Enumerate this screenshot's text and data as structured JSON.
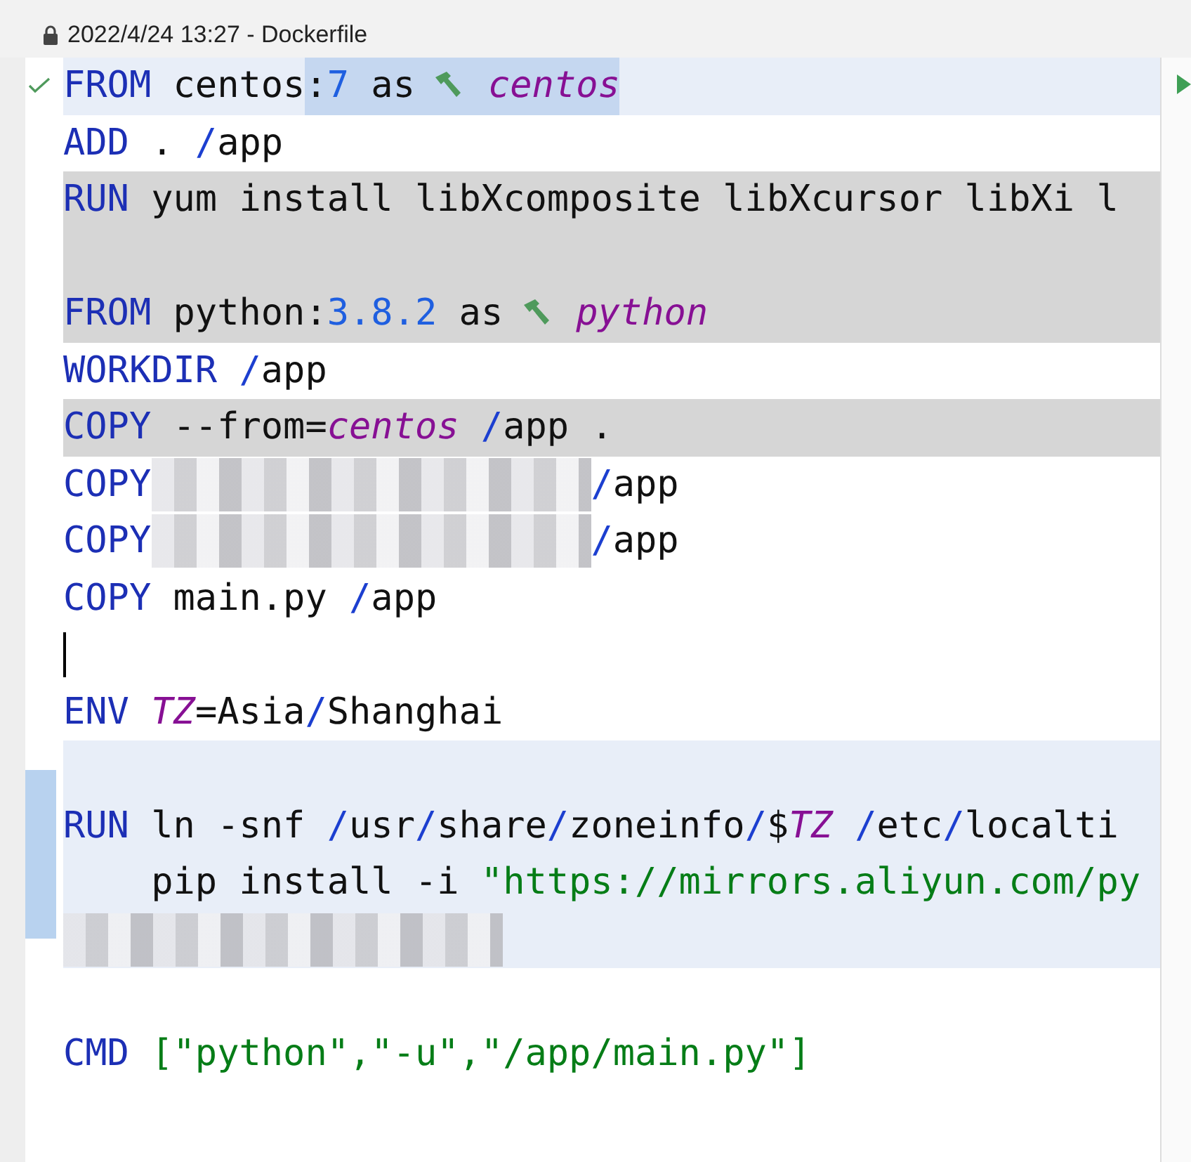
{
  "title": {
    "text": "2022/4/24 13:27 - Dockerfile",
    "locked": true
  },
  "lines": [
    {
      "kind": "current",
      "gutter": {
        "kind": "check"
      },
      "tokens": [
        {
          "kind": "kw",
          "t": "FROM"
        },
        {
          "kind": "plain",
          "t": " centos"
        },
        {
          "kind": "selection",
          "children": [
            {
              "kind": "plain",
              "t": ":"
            },
            {
              "kind": "num",
              "t": "7"
            },
            {
              "kind": "plain",
              "t": " as"
            },
            {
              "kind": "hammer"
            },
            {
              "kind": "var",
              "t": "centos"
            }
          ]
        }
      ]
    },
    {
      "kind": "plain",
      "tokens": [
        {
          "kind": "kw",
          "t": "ADD"
        },
        {
          "kind": "plain",
          "t": " ."
        },
        {
          "kind": "op",
          "t": " /"
        },
        {
          "kind": "plain",
          "t": "app"
        }
      ]
    },
    {
      "kind": "gray",
      "tokens": [
        {
          "kind": "kw",
          "t": "RUN"
        },
        {
          "kind": "plain",
          "t": " yum install libXcomposite libXcursor libXi l"
        }
      ]
    },
    {
      "kind": "gray"
    },
    {
      "kind": "gray",
      "tokens": [
        {
          "kind": "kw",
          "t": "FROM"
        },
        {
          "kind": "plain",
          "t": " python:"
        },
        {
          "kind": "num",
          "t": "3.8.2"
        },
        {
          "kind": "plain",
          "t": " as"
        },
        {
          "kind": "hammer"
        },
        {
          "kind": "var",
          "t": "python"
        }
      ]
    },
    {
      "kind": "plain",
      "tokens": [
        {
          "kind": "kw",
          "t": "WORKDIR"
        },
        {
          "kind": "op",
          "t": " /"
        },
        {
          "kind": "plain",
          "t": "app"
        }
      ]
    },
    {
      "kind": "gray",
      "tokens": [
        {
          "kind": "kw",
          "t": "COPY"
        },
        {
          "kind": "plain",
          "t": " --from="
        },
        {
          "kind": "var",
          "t": "centos"
        },
        {
          "kind": "op",
          "t": " /"
        },
        {
          "kind": "plain",
          "t": "app ."
        }
      ]
    },
    {
      "kind": "plain",
      "tokens": [
        {
          "kind": "kw",
          "t": "COPY"
        },
        {
          "kind": "blur"
        },
        {
          "kind": "op",
          "t": "/"
        },
        {
          "kind": "plain",
          "t": "app"
        }
      ]
    },
    {
      "kind": "plain",
      "tokens": [
        {
          "kind": "kw",
          "t": "COPY"
        },
        {
          "kind": "blur"
        },
        {
          "kind": "op",
          "t": "/"
        },
        {
          "kind": "plain",
          "t": "app"
        }
      ]
    },
    {
      "kind": "plain",
      "tokens": [
        {
          "kind": "kw",
          "t": "COPY"
        },
        {
          "kind": "plain",
          "t": " main.py"
        },
        {
          "kind": "op",
          "t": " /"
        },
        {
          "kind": "plain",
          "t": "app"
        }
      ]
    },
    {
      "kind": "plain",
      "caret": true
    },
    {
      "kind": "plain",
      "tokens": [
        {
          "kind": "kw",
          "t": "ENV"
        },
        {
          "kind": "var",
          "t": " TZ"
        },
        {
          "kind": "plain",
          "t": "=Asia"
        },
        {
          "kind": "op",
          "t": "/"
        },
        {
          "kind": "plain",
          "t": "Shanghai"
        }
      ]
    },
    {
      "kind": "blue"
    },
    {
      "kind": "blue",
      "gutter": {
        "kind": "change"
      },
      "tokens": [
        {
          "kind": "kw",
          "t": "RUN"
        },
        {
          "kind": "plain",
          "t": " ln -snf"
        },
        {
          "kind": "op",
          "t": " /"
        },
        {
          "kind": "plain",
          "t": "usr"
        },
        {
          "kind": "op",
          "t": "/"
        },
        {
          "kind": "plain",
          "t": "share"
        },
        {
          "kind": "op",
          "t": "/"
        },
        {
          "kind": "plain",
          "t": "zoneinfo"
        },
        {
          "kind": "op",
          "t": "/"
        },
        {
          "kind": "plain",
          "t": "$"
        },
        {
          "kind": "var",
          "t": "TZ"
        },
        {
          "kind": "op",
          "t": " /"
        },
        {
          "kind": "plain",
          "t": "etc"
        },
        {
          "kind": "op",
          "t": "/"
        },
        {
          "kind": "plain",
          "t": "localti"
        }
      ]
    },
    {
      "kind": "blue",
      "tokens": [
        {
          "kind": "plain",
          "t": "    pip install -i"
        },
        {
          "kind": "str",
          "t": " \"https://mirrors.aliyun.com/py"
        }
      ]
    },
    {
      "kind": "blue",
      "tokens": [
        {
          "kind": "blur"
        }
      ]
    },
    {
      "kind": "plain"
    },
    {
      "kind": "plain",
      "tokens": [
        {
          "kind": "kw",
          "t": "CMD"
        },
        {
          "kind": "str",
          "t": " [\"python\",\"-u\",\"/app/main.py\"]"
        }
      ]
    }
  ]
}
